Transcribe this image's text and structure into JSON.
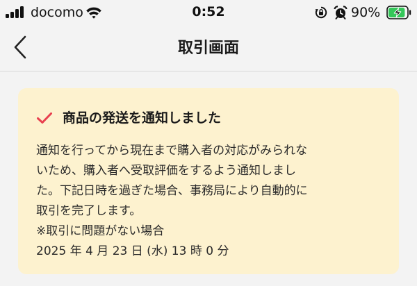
{
  "status_bar": {
    "carrier": "docomo",
    "time": "0:52",
    "battery_percent": "90%",
    "battery_level": 0.9,
    "icons": [
      "signal-icon",
      "wifi-icon",
      "rotation-lock-icon",
      "alarm-icon",
      "battery-charging-icon"
    ]
  },
  "header": {
    "back_icon": "chevron-left-icon",
    "title": "取引画面"
  },
  "notice": {
    "icon": "check-icon",
    "title": "商品の発送を通知しました",
    "lines": [
      "通知を行ってから現在まで購入者の対応がみられな",
      "いため、購入者へ受取評価をするよう通知しまし",
      "た。下記日時を過ぎた場合、事務局により自動的に",
      "取引を完了します。",
      "※取引に問題がない場合",
      "2025 年 4 月 23 日 (水) 13 時 0 分"
    ]
  },
  "colors": {
    "background": "#f3f3f3",
    "notice_background": "#fdf2cf",
    "accent_check": "#e8404f",
    "battery_green": "#34c759"
  }
}
